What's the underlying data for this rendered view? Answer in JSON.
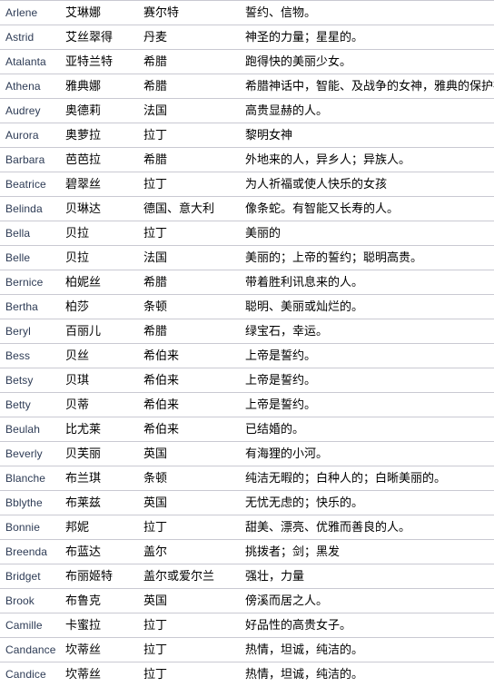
{
  "table": {
    "columns": [
      "english_name",
      "chinese_name",
      "origin",
      "meaning"
    ],
    "rows": [
      {
        "english_name": "Arlene",
        "chinese_name": "艾琳娜",
        "origin": "赛尔特",
        "meaning": "誓约、信物。"
      },
      {
        "english_name": "Astrid",
        "chinese_name": "艾丝翠得",
        "origin": "丹麦",
        "meaning": "神圣的力量；星星的。"
      },
      {
        "english_name": "Atalanta",
        "chinese_name": "亚特兰特",
        "origin": "希腊",
        "meaning": "跑得快的美丽少女。"
      },
      {
        "english_name": "Athena",
        "chinese_name": "雅典娜",
        "origin": "希腊",
        "meaning": "希腊神话中，智能、及战争的女神，雅典的保护神"
      },
      {
        "english_name": "Audrey",
        "chinese_name": "奥德莉",
        "origin": "法国",
        "meaning": "高贵显赫的人。"
      },
      {
        "english_name": "Aurora",
        "chinese_name": "奥萝拉",
        "origin": "拉丁",
        "meaning": "黎明女神"
      },
      {
        "english_name": "Barbara",
        "chinese_name": "芭芭拉",
        "origin": "希腊",
        "meaning": "外地来的人，异乡人；异族人。"
      },
      {
        "english_name": "Beatrice",
        "chinese_name": "碧翠丝",
        "origin": "拉丁",
        "meaning": "为人祈福或使人快乐的女孩"
      },
      {
        "english_name": "Belinda",
        "chinese_name": "贝琳达",
        "origin": "德国、意大利",
        "meaning": "像条蛇。有智能又长寿的人。"
      },
      {
        "english_name": "Bella",
        "chinese_name": "贝拉",
        "origin": "拉丁",
        "meaning": "美丽的"
      },
      {
        "english_name": "Belle",
        "chinese_name": "贝拉",
        "origin": "法国",
        "meaning": "美丽的；上帝的誓约；聪明高贵。"
      },
      {
        "english_name": "Bernice",
        "chinese_name": "柏妮丝",
        "origin": "希腊",
        "meaning": "带着胜利讯息来的人。"
      },
      {
        "english_name": "Bertha",
        "chinese_name": "柏莎",
        "origin": "条顿",
        "meaning": "聪明、美丽或灿烂的。"
      },
      {
        "english_name": "Beryl",
        "chinese_name": "百丽儿",
        "origin": "希腊",
        "meaning": "绿宝石，幸运。"
      },
      {
        "english_name": "Bess",
        "chinese_name": "贝丝",
        "origin": "希伯来",
        "meaning": "上帝是誓约。"
      },
      {
        "english_name": "Betsy",
        "chinese_name": "贝琪",
        "origin": "希伯来",
        "meaning": "上帝是誓约。"
      },
      {
        "english_name": "Betty",
        "chinese_name": "贝蒂",
        "origin": "希伯来",
        "meaning": "上帝是誓约。"
      },
      {
        "english_name": "Beulah",
        "chinese_name": "比尤莱",
        "origin": "希伯来",
        "meaning": "已结婚的。"
      },
      {
        "english_name": "Beverly",
        "chinese_name": "贝芙丽",
        "origin": "英国",
        "meaning": "有海狸的小河。"
      },
      {
        "english_name": "Blanche",
        "chinese_name": "布兰琪",
        "origin": "条顿",
        "meaning": "纯洁无暇的；白种人的；白晰美丽的。"
      },
      {
        "english_name": "Bblythe",
        "chinese_name": "布莱兹",
        "origin": "英国",
        "meaning": "无忧无虑的；快乐的。"
      },
      {
        "english_name": "Bonnie",
        "chinese_name": "邦妮",
        "origin": "拉丁",
        "meaning": "甜美、漂亮、优雅而善良的人。"
      },
      {
        "english_name": "Breenda",
        "chinese_name": "布蓝达",
        "origin": "盖尔",
        "meaning": "挑拨者；剑；黑发"
      },
      {
        "english_name": "Bridget",
        "chinese_name": "布丽姬特",
        "origin": "盖尔或爱尔兰",
        "meaning": "强壮，力量"
      },
      {
        "english_name": "Brook",
        "chinese_name": "布鲁克",
        "origin": "英国",
        "meaning": "傍溪而居之人。"
      },
      {
        "english_name": "Camille",
        "chinese_name": "卡蜜拉",
        "origin": "拉丁",
        "meaning": "好品性的高贵女子。"
      },
      {
        "english_name": "Candance",
        "chinese_name": "坎蒂丝",
        "origin": "拉丁",
        "meaning": "热情，坦诚，纯洁的。"
      },
      {
        "english_name": "Candice",
        "chinese_name": "坎蒂丝",
        "origin": "拉丁",
        "meaning": "热情，坦诚，纯洁的。"
      }
    ]
  },
  "colors": {
    "english_name_text": "#2d3b55",
    "body_text": "#000000",
    "row_separator": "#c9c9d2",
    "background": "#ffffff"
  }
}
